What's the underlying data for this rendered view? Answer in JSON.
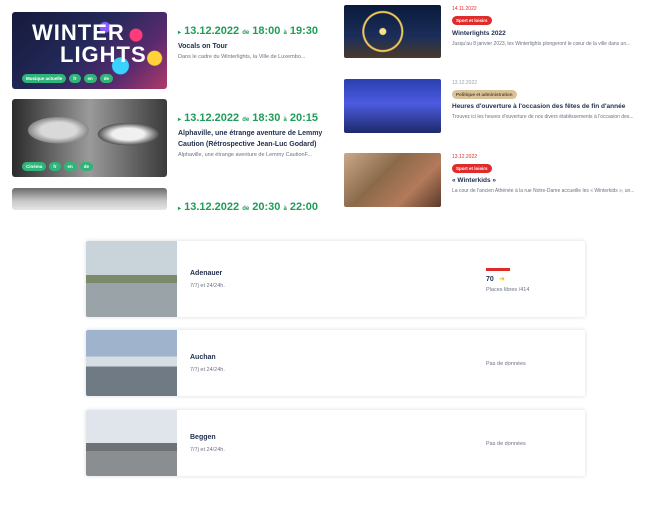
{
  "events": [
    {
      "image_text_line1": "WINTER",
      "image_text_line2": "LIGHTS",
      "date": "13.12.2022",
      "from_label": "de",
      "start": "18:00",
      "to_label": "à",
      "end": "19:30",
      "title": "Vocals on Tour",
      "desc": "Dans le cadre du Winterlights, la Ville de Luxembo...",
      "pills": [
        "Musique actuelle",
        "fr",
        "en",
        "de"
      ]
    },
    {
      "date": "13.12.2022",
      "from_label": "de",
      "start": "18:30",
      "to_label": "à",
      "end": "20:15",
      "title": "Alphaville, une étrange aventure de Lemmy Caution (Rétrospective Jean-Luc Godard)",
      "desc": "Alphaville, une étrange aventure de Lemmy CautionF...",
      "pills": [
        "Cinéma",
        "fr",
        "en",
        "de"
      ]
    },
    {
      "date": "13.12.2022",
      "from_label": "de",
      "start": "20:30",
      "to_label": "à",
      "end": "22:00"
    }
  ],
  "news": [
    {
      "date": "14.11.2022",
      "badge": "Sport et loisirs",
      "title": "Winterlights 2022",
      "desc": "Jusqu'au 8 janvier 2023, les Winterlights plongeront le cœur de la ville dans un..."
    },
    {
      "date": "13.12.2022",
      "badge": "Politique et administration",
      "title": "Heures d'ouverture à l'occasion des fêtes de fin d'année",
      "desc": "Trouvez ici les heures d'ouverture de nos divers établissements à l'occasion des..."
    },
    {
      "date": "13.12.2022",
      "badge": "Sport et loisirs",
      "title": "« Winterkids »",
      "desc": "La cour de l'ancien Athénée à la rue Notre-Dame accueille les « Winterkids », un..."
    }
  ],
  "parkings": [
    {
      "name": "Adenauer",
      "hours": "7/7j et 24/24h.",
      "free": "70",
      "free_label": "Places libres /414",
      "occupancy_fraction": 0.83
    },
    {
      "name": "Auchan",
      "hours": "7/7j et 24/24h.",
      "status": "Pas de données"
    },
    {
      "name": "Beggen",
      "hours": "7/7j et 24/24h.",
      "status": "Pas de données"
    }
  ],
  "colors": {
    "accent_green": "#1f9d57",
    "badge_red": "#e02b2b",
    "badge_sand": "#d9c29a",
    "navy": "#1f2d4d"
  }
}
